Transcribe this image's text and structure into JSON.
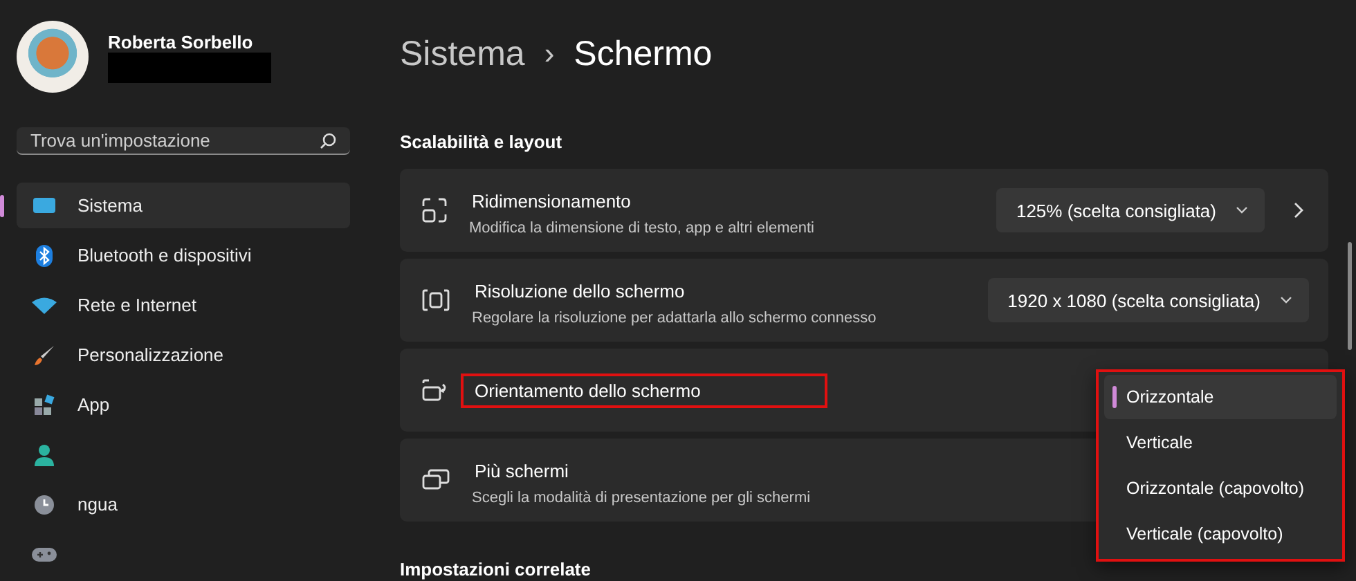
{
  "user": {
    "name": "Roberta Sorbello",
    "email_redacted": true
  },
  "search": {
    "placeholder": "Trova un'impostazione"
  },
  "sidebar": {
    "items": [
      {
        "kind": "system",
        "label": "Sistema",
        "selected": true
      },
      {
        "kind": "bluetooth",
        "label": "Bluetooth e dispositivi",
        "selected": false
      },
      {
        "kind": "network",
        "label": "Rete e Internet",
        "selected": false
      },
      {
        "kind": "brush",
        "label": "Personalizzazione",
        "selected": false
      },
      {
        "kind": "apps",
        "label": "App",
        "selected": false
      },
      {
        "kind": "account",
        "selected": false
      },
      {
        "kind": "time",
        "label": "ngua",
        "selected": false
      },
      {
        "kind": "gaming",
        "selected": false
      }
    ]
  },
  "breadcrumb": {
    "parent": "Sistema",
    "separator": "›",
    "current": "Schermo"
  },
  "section_title": "Scalabilità e layout",
  "cards": [
    {
      "kind": "scale",
      "title": "Ridimensionamento",
      "subtitle": "Modifica la dimensione di testo, app e altri elementi",
      "dropdown": "125% (scelta consigliata)",
      "chevron": true,
      "highlighted": false
    },
    {
      "kind": "resolution",
      "title": "Risoluzione dello schermo",
      "subtitle": "Regolare la risoluzione per adattarla allo schermo connesso",
      "dropdown": "1920 x 1080 (scelta consigliata)",
      "chevron": false,
      "highlighted": false
    },
    {
      "kind": "orientation",
      "title": "Orientamento dello schermo",
      "highlighted": true
    },
    {
      "kind": "multi",
      "title": "Più schermi",
      "subtitle": "Scegli la modalità di presentazione per gli schermi",
      "highlighted": false
    }
  ],
  "flyout": {
    "highlighted": true,
    "options": [
      {
        "label": "Orizzontale",
        "selected": true
      },
      {
        "label": "Verticale",
        "selected": false
      },
      {
        "label": "Orizzontale (capovolto)",
        "selected": false
      },
      {
        "label": "Verticale (capovolto)",
        "selected": false
      }
    ]
  },
  "related_title": "Impostazioni correlate"
}
